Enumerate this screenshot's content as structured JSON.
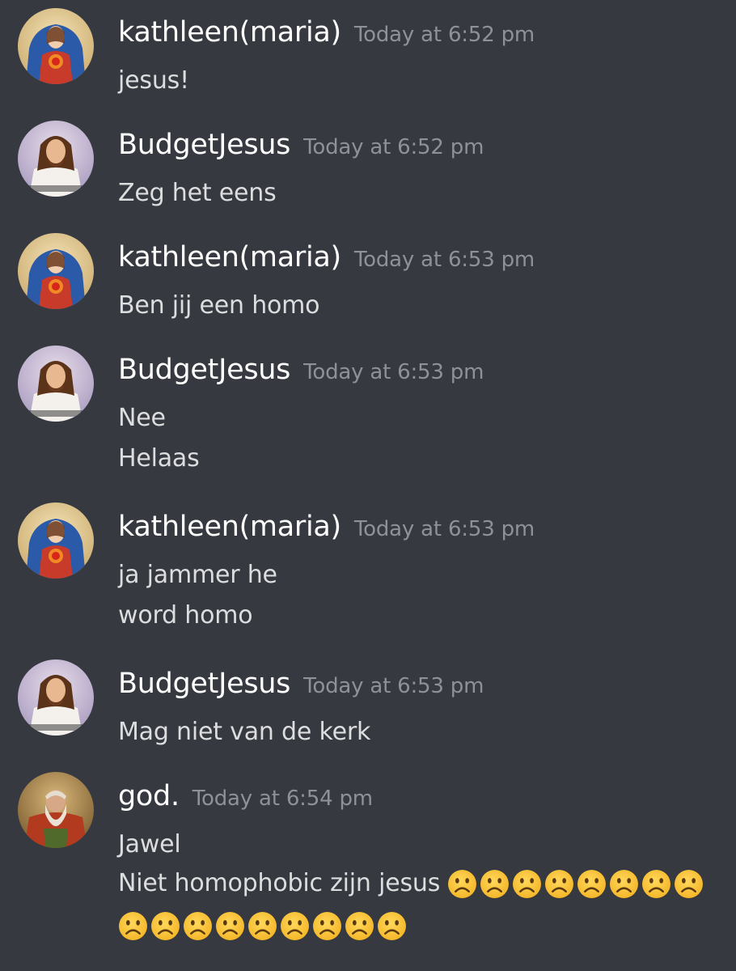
{
  "messages": [
    {
      "author": "kathleen(maria)",
      "avatar": "mary-avatar",
      "timestamp": "Today at 6:52 pm",
      "lines": [
        "jesus!"
      ]
    },
    {
      "author": "BudgetJesus",
      "avatar": "jesus-avatar",
      "timestamp": "Today at 6:52 pm",
      "lines": [
        "Zeg het eens"
      ]
    },
    {
      "author": "kathleen(maria)",
      "avatar": "mary-avatar",
      "timestamp": "Today at 6:53 pm",
      "lines": [
        "Ben jij een homo"
      ]
    },
    {
      "author": "BudgetJesus",
      "avatar": "jesus-avatar",
      "timestamp": "Today at 6:53 pm",
      "lines": [
        "Nee",
        "Helaas"
      ]
    },
    {
      "author": "kathleen(maria)",
      "avatar": "mary-avatar",
      "timestamp": "Today at 6:53 pm",
      "lines": [
        "ja jammer he",
        "word homo"
      ]
    },
    {
      "author": "BudgetJesus",
      "avatar": "jesus-avatar",
      "timestamp": "Today at 6:53 pm",
      "lines": [
        "Mag niet van de kerk"
      ]
    },
    {
      "author": "god.",
      "avatar": "god-avatar",
      "timestamp": "Today at 6:54 pm",
      "lines": [
        "Jawel",
        "Niet homophobic zijn jesus"
      ]
    }
  ],
  "emoji": {
    "name": "frowning-face-icon",
    "line2_count": 8,
    "line3_count": 9
  },
  "colors": {
    "background": "#36393f",
    "username": "#ffffff",
    "timestamp": "#8e9297",
    "text": "#dcddde"
  }
}
